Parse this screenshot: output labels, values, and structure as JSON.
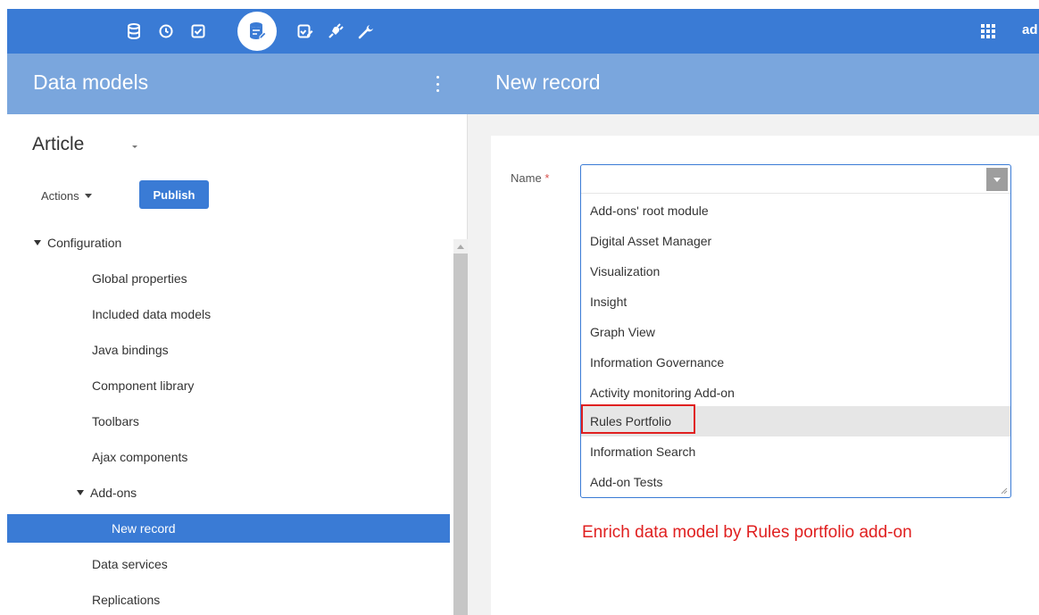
{
  "topbar": {
    "icons": [
      "database-icon",
      "clock-icon",
      "check-square-icon",
      "data-model-icon",
      "edit-check-icon",
      "plug-icon",
      "wrench-icon"
    ],
    "active_icon": "data-model-icon",
    "user_label": "ad",
    "color": "#3a7bd5"
  },
  "header": {
    "left_title": "Data models",
    "right_title": "New record",
    "color": "#7aa6dd"
  },
  "sidebar": {
    "model_name": "Article",
    "actions_label": "Actions",
    "publish_label": "Publish",
    "tree": [
      {
        "label": "Configuration",
        "expanded": true
      },
      {
        "label": "Global properties"
      },
      {
        "label": "Included data models"
      },
      {
        "label": "Java bindings"
      },
      {
        "label": "Component library"
      },
      {
        "label": "Toolbars"
      },
      {
        "label": "Ajax components"
      },
      {
        "label": "Add-ons",
        "expanded": true
      },
      {
        "label": "New record",
        "selected": true
      },
      {
        "label": "Data services"
      },
      {
        "label": "Replications"
      }
    ]
  },
  "form": {
    "name_label": "Name",
    "required_marker": "*",
    "name_value": "",
    "options": [
      "Add-ons' root module",
      "Digital Asset Manager",
      "Visualization",
      "Insight",
      "Graph View",
      "Information Governance",
      "Activity monitoring Add-on",
      "Rules Portfolio",
      "Information Search",
      "Add-on Tests"
    ],
    "highlighted_option": "Rules Portfolio",
    "annotation": "Enrich data model by Rules portfolio add-on",
    "annotation_color": "#e02020"
  }
}
